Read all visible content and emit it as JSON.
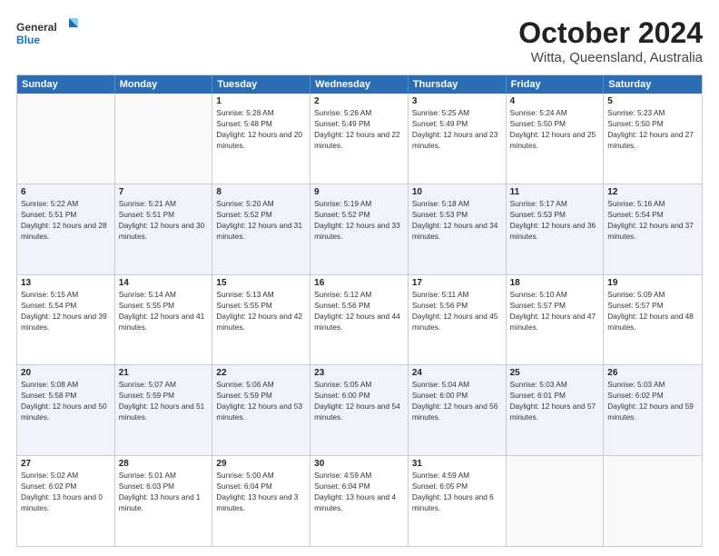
{
  "logo": {
    "general": "General",
    "blue": "Blue"
  },
  "title": "October 2024",
  "subtitle": "Witta, Queensland, Australia",
  "weekdays": [
    "Sunday",
    "Monday",
    "Tuesday",
    "Wednesday",
    "Thursday",
    "Friday",
    "Saturday"
  ],
  "rows": [
    [
      {
        "day": "",
        "info": ""
      },
      {
        "day": "",
        "info": ""
      },
      {
        "day": "1",
        "info": "Sunrise: 5:28 AM\nSunset: 5:48 PM\nDaylight: 12 hours and 20 minutes."
      },
      {
        "day": "2",
        "info": "Sunrise: 5:26 AM\nSunset: 5:49 PM\nDaylight: 12 hours and 22 minutes."
      },
      {
        "day": "3",
        "info": "Sunrise: 5:25 AM\nSunset: 5:49 PM\nDaylight: 12 hours and 23 minutes."
      },
      {
        "day": "4",
        "info": "Sunrise: 5:24 AM\nSunset: 5:50 PM\nDaylight: 12 hours and 25 minutes."
      },
      {
        "day": "5",
        "info": "Sunrise: 5:23 AM\nSunset: 5:50 PM\nDaylight: 12 hours and 27 minutes."
      }
    ],
    [
      {
        "day": "6",
        "info": "Sunrise: 5:22 AM\nSunset: 5:51 PM\nDaylight: 12 hours and 28 minutes."
      },
      {
        "day": "7",
        "info": "Sunrise: 5:21 AM\nSunset: 5:51 PM\nDaylight: 12 hours and 30 minutes."
      },
      {
        "day": "8",
        "info": "Sunrise: 5:20 AM\nSunset: 5:52 PM\nDaylight: 12 hours and 31 minutes."
      },
      {
        "day": "9",
        "info": "Sunrise: 5:19 AM\nSunset: 5:52 PM\nDaylight: 12 hours and 33 minutes."
      },
      {
        "day": "10",
        "info": "Sunrise: 5:18 AM\nSunset: 5:53 PM\nDaylight: 12 hours and 34 minutes."
      },
      {
        "day": "11",
        "info": "Sunrise: 5:17 AM\nSunset: 5:53 PM\nDaylight: 12 hours and 36 minutes."
      },
      {
        "day": "12",
        "info": "Sunrise: 5:16 AM\nSunset: 5:54 PM\nDaylight: 12 hours and 37 minutes."
      }
    ],
    [
      {
        "day": "13",
        "info": "Sunrise: 5:15 AM\nSunset: 5:54 PM\nDaylight: 12 hours and 39 minutes."
      },
      {
        "day": "14",
        "info": "Sunrise: 5:14 AM\nSunset: 5:55 PM\nDaylight: 12 hours and 41 minutes."
      },
      {
        "day": "15",
        "info": "Sunrise: 5:13 AM\nSunset: 5:55 PM\nDaylight: 12 hours and 42 minutes."
      },
      {
        "day": "16",
        "info": "Sunrise: 5:12 AM\nSunset: 5:56 PM\nDaylight: 12 hours and 44 minutes."
      },
      {
        "day": "17",
        "info": "Sunrise: 5:11 AM\nSunset: 5:56 PM\nDaylight: 12 hours and 45 minutes."
      },
      {
        "day": "18",
        "info": "Sunrise: 5:10 AM\nSunset: 5:57 PM\nDaylight: 12 hours and 47 minutes."
      },
      {
        "day": "19",
        "info": "Sunrise: 5:09 AM\nSunset: 5:57 PM\nDaylight: 12 hours and 48 minutes."
      }
    ],
    [
      {
        "day": "20",
        "info": "Sunrise: 5:08 AM\nSunset: 5:58 PM\nDaylight: 12 hours and 50 minutes."
      },
      {
        "day": "21",
        "info": "Sunrise: 5:07 AM\nSunset: 5:59 PM\nDaylight: 12 hours and 51 minutes."
      },
      {
        "day": "22",
        "info": "Sunrise: 5:06 AM\nSunset: 5:59 PM\nDaylight: 12 hours and 53 minutes."
      },
      {
        "day": "23",
        "info": "Sunrise: 5:05 AM\nSunset: 6:00 PM\nDaylight: 12 hours and 54 minutes."
      },
      {
        "day": "24",
        "info": "Sunrise: 5:04 AM\nSunset: 6:00 PM\nDaylight: 12 hours and 56 minutes."
      },
      {
        "day": "25",
        "info": "Sunrise: 5:03 AM\nSunset: 6:01 PM\nDaylight: 12 hours and 57 minutes."
      },
      {
        "day": "26",
        "info": "Sunrise: 5:03 AM\nSunset: 6:02 PM\nDaylight: 12 hours and 59 minutes."
      }
    ],
    [
      {
        "day": "27",
        "info": "Sunrise: 5:02 AM\nSunset: 6:02 PM\nDaylight: 13 hours and 0 minutes."
      },
      {
        "day": "28",
        "info": "Sunrise: 5:01 AM\nSunset: 6:03 PM\nDaylight: 13 hours and 1 minute."
      },
      {
        "day": "29",
        "info": "Sunrise: 5:00 AM\nSunset: 6:04 PM\nDaylight: 13 hours and 3 minutes."
      },
      {
        "day": "30",
        "info": "Sunrise: 4:59 AM\nSunset: 6:04 PM\nDaylight: 13 hours and 4 minutes."
      },
      {
        "day": "31",
        "info": "Sunrise: 4:59 AM\nSunset: 6:05 PM\nDaylight: 13 hours and 6 minutes."
      },
      {
        "day": "",
        "info": ""
      },
      {
        "day": "",
        "info": ""
      }
    ]
  ]
}
